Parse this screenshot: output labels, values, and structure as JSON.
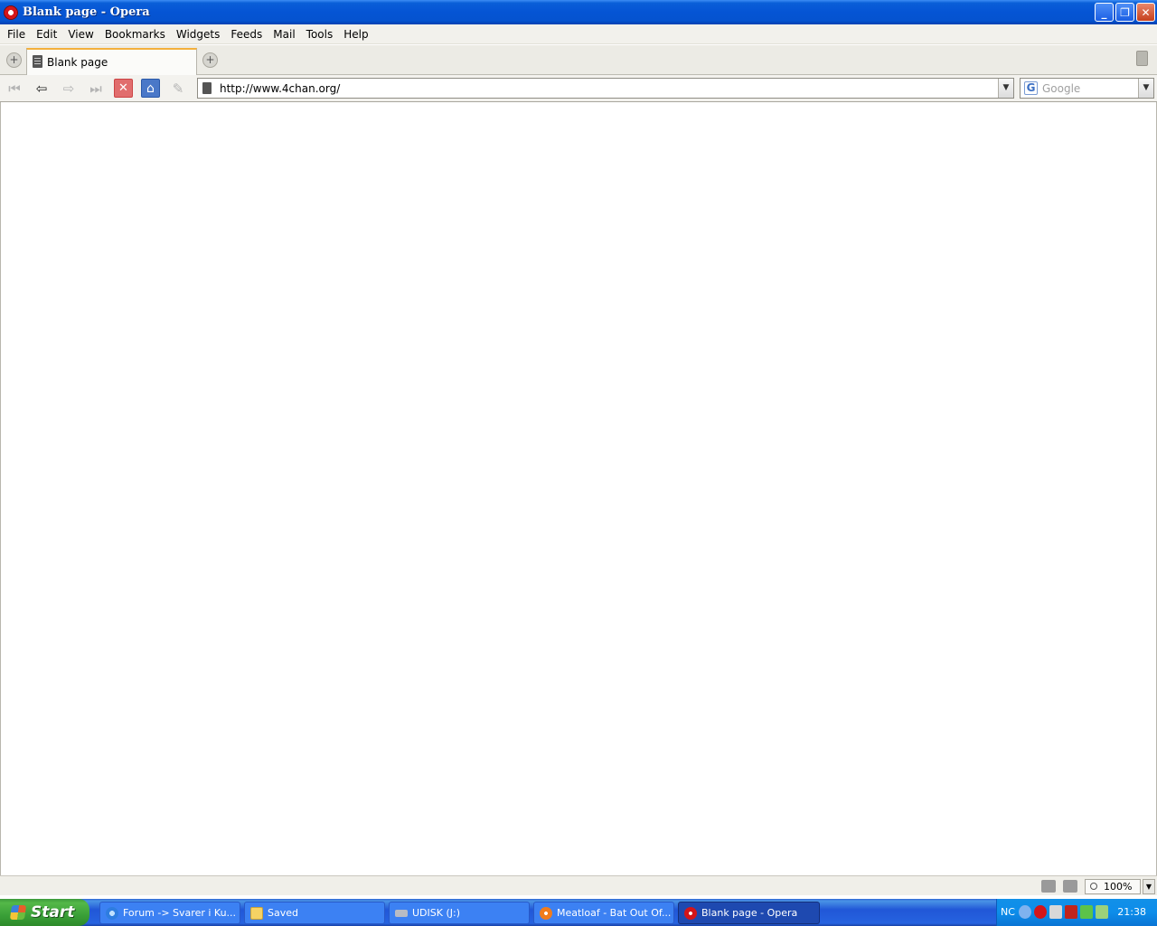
{
  "window": {
    "title": "Blank page - Opera",
    "buttons": {
      "minimize": "_",
      "maximize": "❐",
      "close": "✕"
    }
  },
  "menu": [
    "File",
    "Edit",
    "View",
    "Bookmarks",
    "Widgets",
    "Feeds",
    "Mail",
    "Tools",
    "Help"
  ],
  "tabs": {
    "active": {
      "label": "Blank page"
    },
    "side_button_icon": "add-circle-icon",
    "new_tab_icon": "add-circle-icon",
    "trash_icon": "trash-icon"
  },
  "nav": {
    "buttons": [
      {
        "name": "rewind-button",
        "glyph": "⏮"
      },
      {
        "name": "back-button",
        "glyph": "⇦"
      },
      {
        "name": "forward-button",
        "glyph": "⇨"
      },
      {
        "name": "fast-forward-button",
        "glyph": "⏭"
      },
      {
        "name": "stop-button",
        "glyph": "✕"
      },
      {
        "name": "home-button",
        "glyph": "⌂"
      },
      {
        "name": "edit-button",
        "glyph": "✎"
      }
    ],
    "address": {
      "value": "http://www.4chan.org/"
    },
    "search": {
      "placeholder": "Google",
      "engine_icon": "G"
    }
  },
  "status": {
    "zoom": "100%"
  },
  "taskbar": {
    "start_label": "Start",
    "items": [
      {
        "label": "Forum -> Svarer i Ku...",
        "icon": "ie-icon",
        "active": false
      },
      {
        "label": "Saved",
        "icon": "folder-icon",
        "active": false
      },
      {
        "label": "UDISK (J:)",
        "icon": "drive-icon",
        "active": false
      },
      {
        "label": "Meatloaf - Bat Out Of...",
        "icon": "media-icon",
        "active": false
      },
      {
        "label": "Blank page - Opera",
        "icon": "opera-icon",
        "active": true
      }
    ],
    "tray": {
      "language": "NC",
      "clock": "21:38"
    }
  },
  "colors": {
    "tab_accent": "#f3b03c",
    "taskbar_blue": "#2157d7",
    "start_green": "#3aa038"
  }
}
